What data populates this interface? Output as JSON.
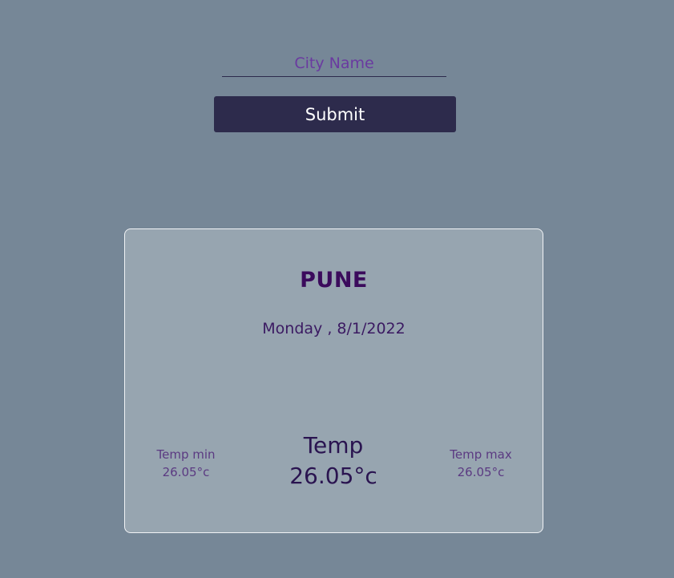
{
  "form": {
    "city_placeholder": "City Name",
    "city_value": "",
    "submit_label": "Submit"
  },
  "weather": {
    "city": "PUNE",
    "date": "Monday , 8/1/2022",
    "temp_label": "Temp",
    "temp_value": "26.05°c",
    "temp_min_label": "Temp min",
    "temp_min_value": "26.05°c",
    "temp_max_label": "Temp max",
    "temp_max_value": "26.05°c"
  },
  "colors": {
    "background": "#768797",
    "card": "#97a5b0",
    "button": "#2d2b4c",
    "accent": "#3b0b5c"
  }
}
